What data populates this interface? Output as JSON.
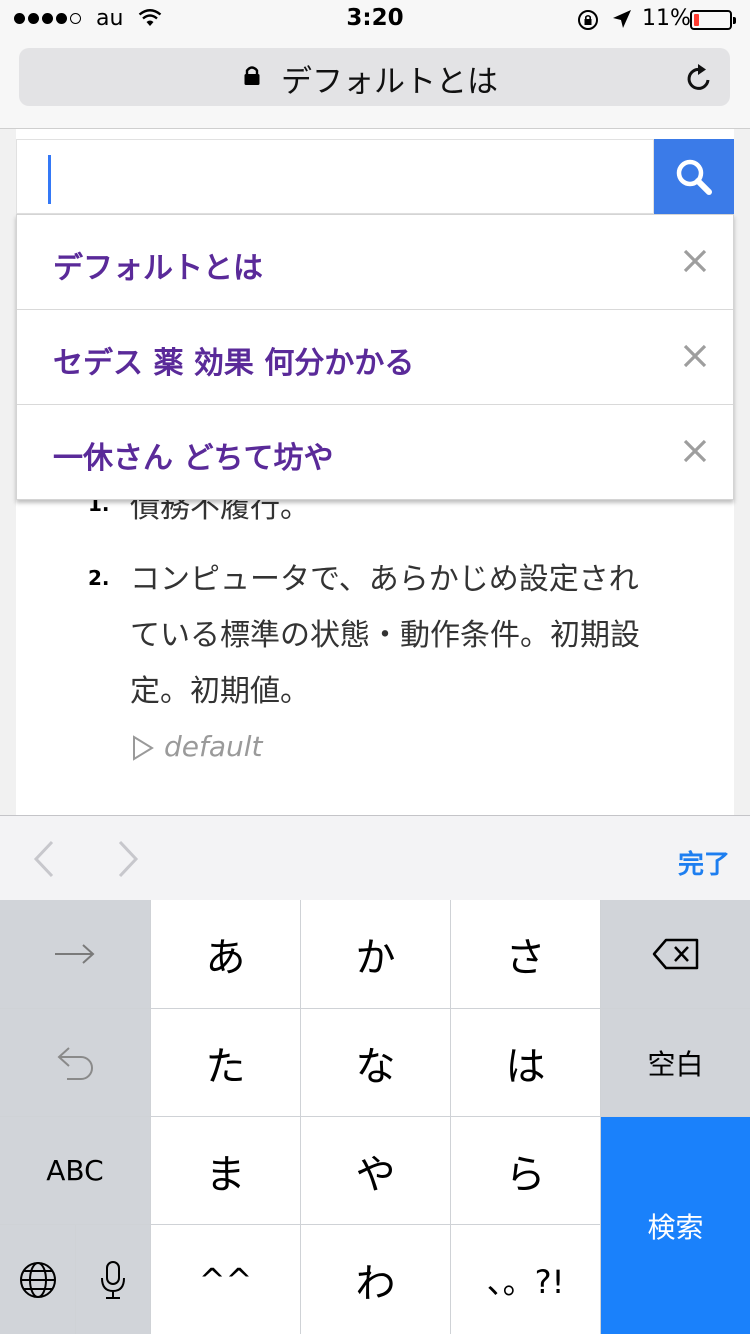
{
  "status_bar": {
    "carrier": "au",
    "time": "3:20",
    "battery": "11%"
  },
  "url_bar": {
    "title": "デフォルトとは"
  },
  "search": {
    "input_value": "",
    "suggestions": [
      {
        "label": "デフォルトとは"
      },
      {
        "label": "セデス 薬 効果 何分かかる"
      },
      {
        "label": "一休さん どちて坊や"
      }
    ]
  },
  "definition": {
    "item1_number": "1.",
    "item1_text": "債務不履行。",
    "item2_number": "2.",
    "item2_line1": "コンピュータで、あらかじめ設定され",
    "item2_line2": "ている標準の状態・動作条件。初期設",
    "item2_line3": "定。初期値。",
    "example": "default"
  },
  "accessory": {
    "done": "完了"
  },
  "keyboard": {
    "row1": [
      "あ",
      "か",
      "さ"
    ],
    "row2": [
      "た",
      "な",
      "は"
    ],
    "row3": [
      "ま",
      "や",
      "ら"
    ],
    "row4": [
      "^^",
      "わ",
      "、。?!"
    ],
    "space": "空白",
    "abc": "ABC",
    "search": "検索"
  },
  "colors": {
    "suggestion_text": "#5a2a99",
    "search_button": "#3b7be8",
    "keyboard_action": "#1a81fb",
    "done_link": "#1d7ef0"
  }
}
